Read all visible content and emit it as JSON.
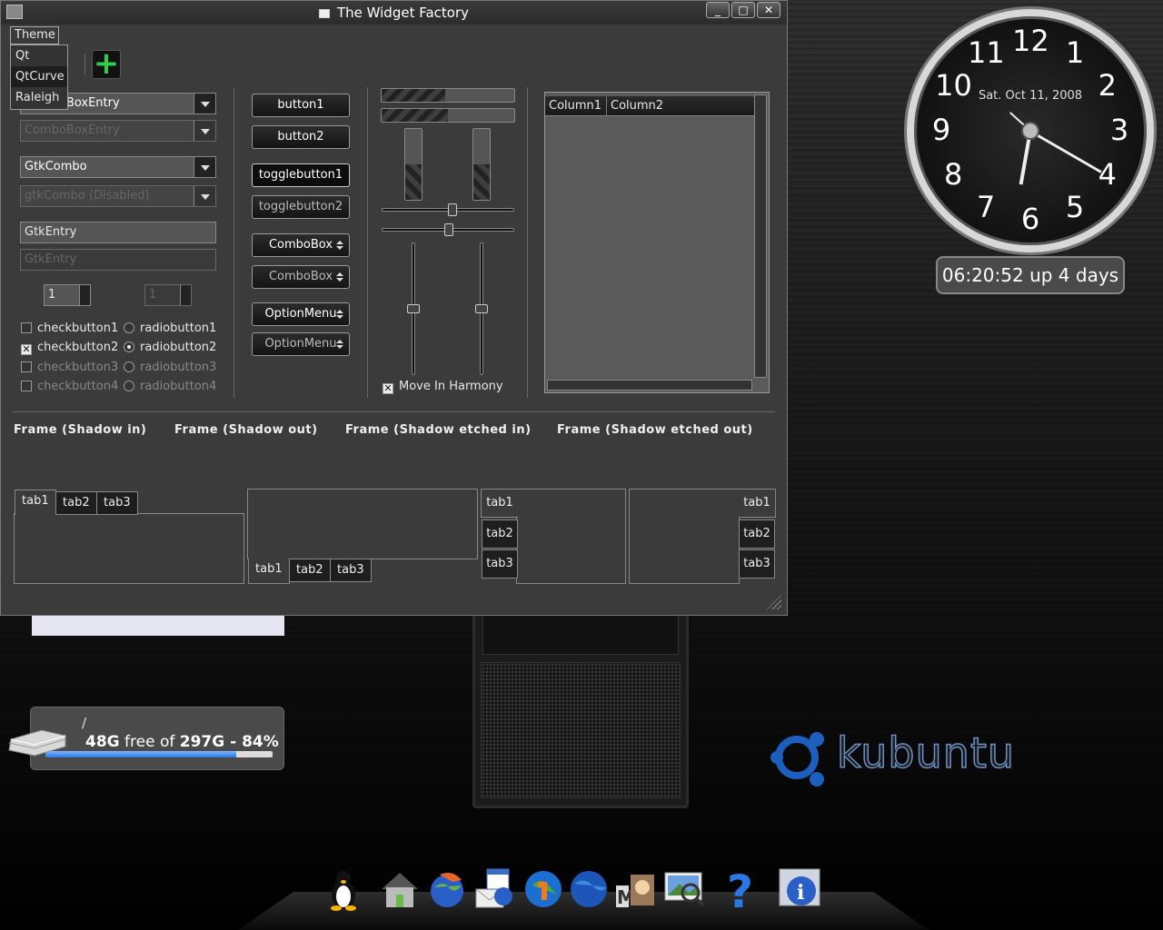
{
  "window": {
    "title": "The Widget Factory",
    "buttons": {
      "minimize": "_",
      "maximize": "□",
      "close": "✕"
    }
  },
  "menu": {
    "theme_label": "Theme",
    "items": [
      "Qt",
      "QtCurve",
      "Raleigh"
    ]
  },
  "col1": {
    "combo_entry_1": "ComboBoxEntry",
    "combo_entry_2": "ComboBoxEntry",
    "gtk_combo": "GtkCombo",
    "gtk_combo_disabled": "gtkCombo (Disabled)",
    "entry_1": "GtkEntry",
    "entry_2": "GtkEntry",
    "spin_1": "1",
    "spin_2": "1",
    "checks": [
      "checkbutton1",
      "checkbutton2",
      "checkbutton3",
      "checkbutton4"
    ],
    "radios": [
      "radiobutton1",
      "radiobutton2",
      "radiobutton3",
      "radiobutton4"
    ]
  },
  "col2": {
    "button1": "button1",
    "button2": "button2",
    "toggle1": "togglebutton1",
    "toggle2": "togglebutton2",
    "combo1": "ComboBox",
    "combo2": "ComboBox",
    "option1": "OptionMenu",
    "option2": "OptionMenu"
  },
  "col3": {
    "harmony_label": "Move In Harmony",
    "hprogress": [
      0.48,
      0.5
    ],
    "vprogress": [
      0.5,
      0.5
    ]
  },
  "tree": {
    "columns": [
      "Column1",
      "Column2"
    ]
  },
  "frames": [
    "Frame (Shadow in)",
    "Frame (Shadow out)",
    "Frame (Shadow etched in)",
    "Frame (Shadow etched out)"
  ],
  "notebooks": {
    "tabs": [
      "tab1",
      "tab2",
      "tab3"
    ]
  },
  "clock": {
    "date": "Sat. Oct 11, 2008",
    "numbers": [
      "12",
      "1",
      "2",
      "3",
      "4",
      "5",
      "6",
      "7",
      "8",
      "9",
      "10",
      "11"
    ]
  },
  "uptime": "06:20:52 up 4 days",
  "disk": {
    "path": "/",
    "free": "48G",
    "free_of": "free of",
    "total_pct": "297G - 84%",
    "used_fraction": 0.84
  },
  "brand": {
    "word": "kubuntu",
    "color": "#6a90c8"
  }
}
